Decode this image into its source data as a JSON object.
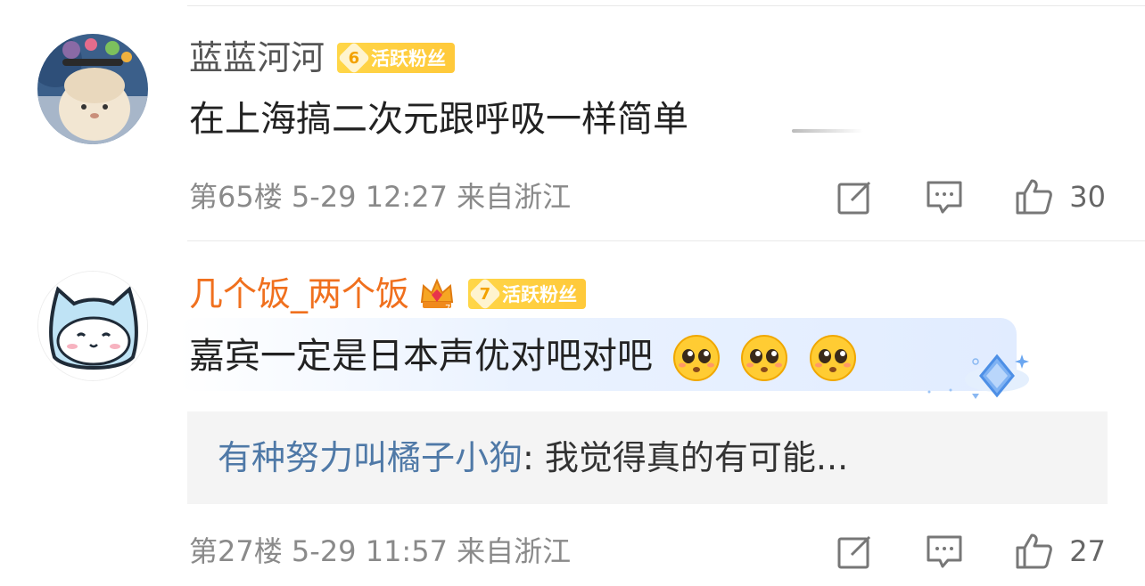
{
  "comments": [
    {
      "username": "蓝蓝河河",
      "level": "6",
      "badge_label": "活跃粉丝",
      "text": "在上海搞二次元跟呼吸一样简单",
      "floor": "第65楼",
      "datetime": "5-29 12:27",
      "location": "来自浙江",
      "likes": "30"
    },
    {
      "username": "几个饭_两个饭",
      "level": "7",
      "badge_label": "活跃粉丝",
      "text": "嘉宾一定是日本声优对吧对吧",
      "reply": {
        "user": "有种努力叫橘子小狗",
        "separator": ": ",
        "text": "我觉得真的有可能..."
      },
      "floor": "第27楼",
      "datetime": "5-29 11:57",
      "location": "来自浙江",
      "likes": "27"
    }
  ],
  "colors": {
    "username_orange": "#f0701e",
    "reply_user_blue": "#4f79a7",
    "badge_yellow": "#ffd648",
    "meta_gray": "#8a8a8a"
  },
  "icons": [
    "edit-icon",
    "comment-icon",
    "thumbs-up-icon",
    "crown-icon",
    "pleading-face-emoji",
    "diamond-decoration-icon"
  ]
}
